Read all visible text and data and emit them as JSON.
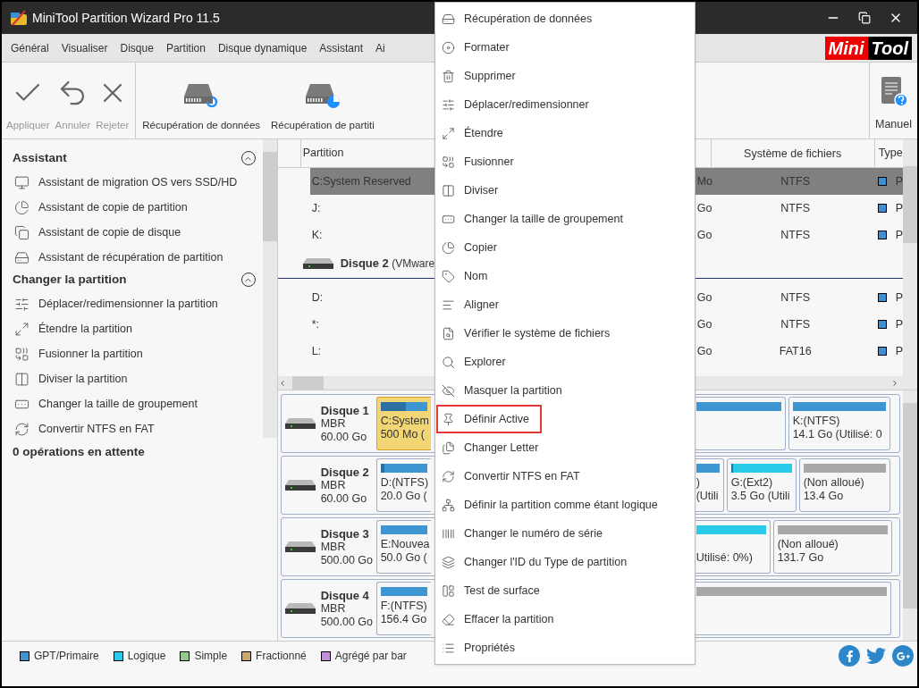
{
  "window": {
    "title": "MiniTool Partition Wizard Pro 11.5"
  },
  "menu_bar": {
    "items": [
      "Général",
      "Visualiser",
      "Disque",
      "Partition",
      "Disque dynamique",
      "Assistant",
      "Ai"
    ],
    "logo": {
      "part_1": "Mini",
      "part_2": "Tool"
    }
  },
  "toolbar": {
    "buttons": [
      {
        "label": "Appliquer",
        "kind": "apply",
        "disabled": true
      },
      {
        "label": "Annuler",
        "kind": "undo",
        "disabled": true
      },
      {
        "label": "Rejeter",
        "kind": "discard",
        "disabled": true
      },
      {
        "label": "Récupération de données",
        "kind": "data_recovery",
        "disabled": false
      },
      {
        "label": "Récupération de partiti",
        "kind": "partition_recovery",
        "disabled": false
      }
    ],
    "manual": {
      "label": "Manuel"
    }
  },
  "sidebar": {
    "sections": [
      {
        "title": "Assistant",
        "expanded": true,
        "items": [
          "Assistant de migration OS vers SSD/HD",
          "Assistant de copie de partition",
          "Assistant de copie de disque",
          "Assistant de récupération de partition"
        ]
      },
      {
        "title": "Changer la partition",
        "expanded": true,
        "items": [
          "Déplacer/redimensionner la partition",
          "Étendre la partition",
          "Fusionner la partition",
          "Diviser la partition",
          "Changer la taille de groupement",
          "Convertir NTFS en FAT"
        ]
      }
    ],
    "pending": "0 opérations en attente"
  },
  "table": {
    "columns": [
      "Partition",
      "Système de fichiers",
      "Type"
    ],
    "rows": [
      {
        "kind": "partition",
        "partition": "C:System Reserved",
        "column_2": "Mo",
        "file_system": "NTFS",
        "type": "P",
        "color": "#3d8fd1",
        "selected": true
      },
      {
        "kind": "partition",
        "partition": "J:",
        "column_2": "Go",
        "file_system": "NTFS",
        "type": "P",
        "color": "#3d8fd1",
        "selected": false
      },
      {
        "kind": "partition",
        "partition": "K:",
        "column_2": "Go",
        "file_system": "NTFS",
        "type": "P",
        "color": "#3d8fd1",
        "selected": false
      },
      {
        "kind": "disk",
        "name": "Disque 2",
        "detail": "(VMware"
      },
      {
        "kind": "partition",
        "partition": "D:",
        "column_2": "Go",
        "file_system": "NTFS",
        "type": "P",
        "color": "#3d8fd1",
        "selected": false
      },
      {
        "kind": "partition",
        "partition": "*:",
        "column_2": "Go",
        "file_system": "NTFS",
        "type": "P",
        "color": "#3d8fd1",
        "selected": false
      },
      {
        "kind": "partition",
        "partition": "L:",
        "column_2": "Go",
        "file_system": "FAT16",
        "type": "P",
        "color": "#3d8fd1",
        "selected": false
      }
    ]
  },
  "disks": [
    {
      "name": "Disque 1",
      "style": "MBR",
      "size": "60.00 Go",
      "partitions": [
        {
          "kind": "left",
          "label": "C:System",
          "size": "500 Mo (",
          "color": "#3d95d1",
          "level": 0.55,
          "selected": true
        },
        {
          "kind": "middle",
          "color": "#3d95d1",
          "selected": false
        },
        {
          "kind": "full",
          "label": "K:(NTFS)",
          "size": "14.1 Go (Utilisé: 0",
          "color": "#3d95d1",
          "selected": false
        }
      ]
    },
    {
      "name": "Disque 2",
      "style": "MBR",
      "size": "60.00 Go",
      "partitions": [
        {
          "kind": "left",
          "label": "D:(NTFS)",
          "size": "20.0 Go (",
          "color": "#3d95d1",
          "level": 0.08,
          "selected": false
        },
        {
          "kind": "middle",
          "label": ")",
          "size": "(Utili",
          "color": "#3d95d1",
          "selected": false
        },
        {
          "kind": "full",
          "label": "G:(Ext2)",
          "size": "3.5 Go (Utili",
          "color": "#29cbe8",
          "level": 0.04,
          "selected": false
        },
        {
          "kind": "full",
          "label": "(Non alloué)",
          "size": "13.4 Go",
          "color": "#a8a8a8",
          "selected": false
        }
      ]
    },
    {
      "name": "Disque 3",
      "style": "MBR",
      "size": "500.00 Go",
      "partitions": [
        {
          "kind": "left",
          "label": "E:Nouvea",
          "size": "50.0 Go (",
          "color": "#3d95d1",
          "selected": false
        },
        {
          "kind": "middle",
          "size": "Utilisé: 0%)",
          "color": "#29cbe8",
          "selected": false
        },
        {
          "kind": "full",
          "label": "(Non alloué)",
          "size": "131.7 Go",
          "color": "#a8a8a8",
          "selected": false
        }
      ]
    },
    {
      "name": "Disque 4",
      "style": "MBR",
      "size": "500.00 Go",
      "partitions": [
        {
          "kind": "left",
          "label": "F:(NTFS)",
          "size": "156.4 Go",
          "color": "#3d95d1",
          "selected": false
        },
        {
          "kind": "middle",
          "color": "#a8a8a8",
          "selected": false
        }
      ]
    }
  ],
  "legend": [
    {
      "label": "GPT/Primaire",
      "color": "#3d95d1"
    },
    {
      "label": "Logique",
      "color": "#29cbe8"
    },
    {
      "label": "Simple",
      "color": "#93c98a"
    },
    {
      "label": "Fractionné",
      "color": "#c9a86a"
    },
    {
      "label": "Agrégé par bar",
      "color": "#c38fd6"
    }
  ],
  "context_menu": {
    "items": [
      {
        "label": "Récupération de données",
        "highlighted": false
      },
      {
        "label": "Formater",
        "highlighted": false
      },
      {
        "label": "Supprimer",
        "highlighted": false
      },
      {
        "label": "Déplacer/redimensionner",
        "highlighted": false
      },
      {
        "label": "Étendre",
        "highlighted": false
      },
      {
        "label": "Fusionner",
        "highlighted": false
      },
      {
        "label": "Diviser",
        "highlighted": false
      },
      {
        "label": "Changer la taille de groupement",
        "highlighted": false
      },
      {
        "label": "Copier",
        "highlighted": false
      },
      {
        "label": "Nom",
        "highlighted": false
      },
      {
        "label": "Aligner",
        "highlighted": false
      },
      {
        "label": "Vérifier le système de fichiers",
        "highlighted": false
      },
      {
        "label": "Explorer",
        "highlighted": false
      },
      {
        "label": "Masquer la partition",
        "highlighted": false
      },
      {
        "label": "Définir Active",
        "highlighted": true
      },
      {
        "label": "Changer Letter",
        "highlighted": false
      },
      {
        "label": "Convertir NTFS en FAT",
        "highlighted": false
      },
      {
        "label": "Définir la partition comme étant logique",
        "highlighted": false
      },
      {
        "label": "Changer le numéro de série",
        "highlighted": false
      },
      {
        "label": "Changer l'ID du Type de partition",
        "highlighted": false
      },
      {
        "label": "Test de surface",
        "highlighted": false
      },
      {
        "label": "Effacer la partition",
        "highlighted": false
      },
      {
        "label": "Propriétés",
        "highlighted": false
      }
    ]
  }
}
